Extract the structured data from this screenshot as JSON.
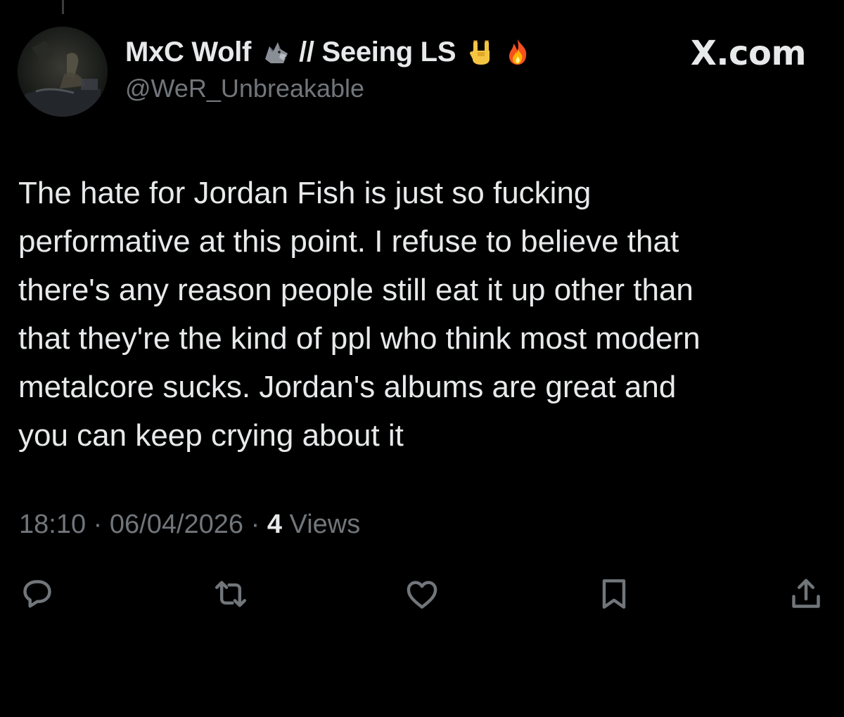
{
  "author": {
    "display_name": "MxC Wolf",
    "name_suffix": "// Seeing LS",
    "handle": "@WeR_Unbreakable",
    "avatar_icon": "dark-photo-avatar",
    "name_emojis": [
      "wolf-emoji",
      "rock-on-hand-emoji",
      "fire-emoji"
    ]
  },
  "brand": {
    "label": "X.com"
  },
  "tweet": {
    "text": "The hate for Jordan Fish is just so fucking\nperformative at this point. I refuse to believe that\nthere's any reason people still eat it up other than\nthat they're the kind of ppl who think most modern\nmetalcore sucks. Jordan's albums are great and\nyou can keep crying about it"
  },
  "meta": {
    "time": "18:10",
    "date": "06/04/2026",
    "separator": "·",
    "views_count": "4",
    "views_label": "Views"
  },
  "actions": [
    {
      "name": "reply-icon"
    },
    {
      "name": "retweet-icon"
    },
    {
      "name": "like-icon"
    },
    {
      "name": "bookmark-icon"
    },
    {
      "name": "share-icon"
    }
  ],
  "colors": {
    "background": "#000000",
    "text_primary": "#e7e9ea",
    "text_secondary": "#71767b"
  }
}
